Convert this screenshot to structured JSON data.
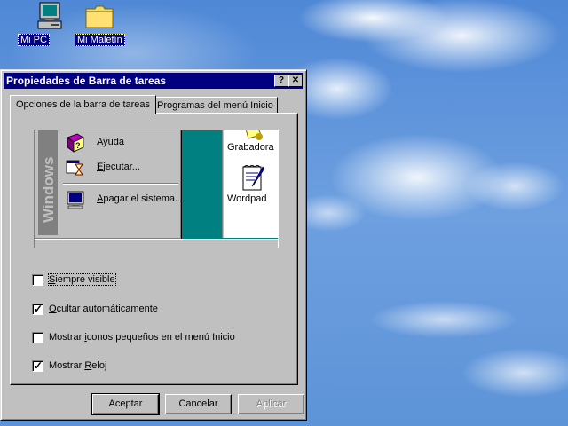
{
  "desktop": {
    "icons": [
      {
        "label": "Mi PC"
      },
      {
        "label": "Mi Maletín"
      }
    ]
  },
  "dialog": {
    "title": "Propiedades de Barra de tareas",
    "help_button": "?",
    "close_button": "✕",
    "tabs": [
      {
        "label": "Opciones de la barra de tareas",
        "active": true
      },
      {
        "label": "Programas del menú Inicio",
        "active": false
      }
    ],
    "preview": {
      "banner": "Windows",
      "menu_items": [
        {
          "pre": "Ay",
          "ul": "u",
          "post": "da"
        },
        {
          "pre": "",
          "ul": "E",
          "post": "jecutar..."
        },
        {
          "pre": "",
          "ul": "A",
          "post": "pagar el sistema..."
        }
      ],
      "explorer_items": [
        {
          "label": "Grabadora"
        },
        {
          "label": "Wordpad"
        }
      ]
    },
    "options": [
      {
        "pre": "",
        "ul": "S",
        "post": "iempre visible",
        "checked": false
      },
      {
        "pre": "",
        "ul": "O",
        "post": "cultar automáticamente",
        "checked": true
      },
      {
        "pre": "Mostrar ",
        "ul": "i",
        "post": "conos pequeños en el menú Inicio",
        "checked": false
      },
      {
        "pre": "Mostrar ",
        "ul": "R",
        "post": "eloj",
        "checked": true
      }
    ],
    "buttons": {
      "accept": "Aceptar",
      "cancel": "Cancelar",
      "apply": "Aplicar"
    },
    "colors": {
      "title_bar": "#000080",
      "face": "#c0c0c0",
      "preview_desktop": "#008080"
    }
  }
}
